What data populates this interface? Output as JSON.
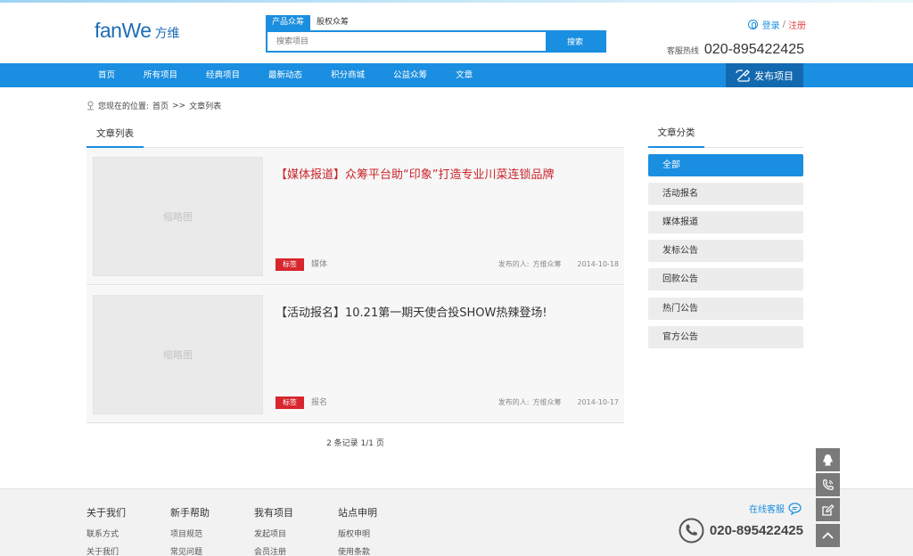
{
  "header": {
    "logo_word": "fanWe",
    "logo_cn": "方维",
    "search_tabs": [
      "产品众筹",
      "股权众筹"
    ],
    "search_placeholder": "搜索项目",
    "search_button": "搜索",
    "login": "登录",
    "separator": "/",
    "register": "注册",
    "hotline_label": "客服热线",
    "hotline_number": "020-895422425"
  },
  "nav": {
    "items": [
      "首页",
      "所有项目",
      "经典项目",
      "最新动态",
      "积分商城",
      "公益众筹",
      "文章"
    ],
    "publish": "发布项目"
  },
  "breadcrumb": {
    "prefix": "您现在的位置:",
    "home": "首页",
    "sep": ">>",
    "current": "文章列表"
  },
  "main": {
    "tab": "文章列表",
    "articles": [
      {
        "thumb": "缩略图",
        "title": "【媒体报道】众筹平台助“印象”打造专业川菜连锁品牌",
        "tag": "标签",
        "tag_value": "媒体",
        "author_label": "发布的人:",
        "author": "方维众筹",
        "date": "2014-10-18"
      },
      {
        "thumb": "缩略图",
        "title": "【活动报名】10.21第一期天使合投SHOW热辣登场!",
        "tag": "标签",
        "tag_value": "报名",
        "author_label": "发布的人:",
        "author": "方维众筹",
        "date": "2014-10-17"
      }
    ],
    "pager": "2 条记录 1/1 页"
  },
  "sidebar": {
    "title": "文章分类",
    "categories": [
      "全部",
      "活动报名",
      "媒体报道",
      "发标公告",
      "回款公告",
      "热门公告",
      "官方公告"
    ]
  },
  "footer": {
    "columns": [
      {
        "head": "关于我们",
        "links": [
          "联系方式",
          "关于我们"
        ]
      },
      {
        "head": "新手帮助",
        "links": [
          "项目规范",
          "常见问题"
        ]
      },
      {
        "head": "我有项目",
        "links": [
          "发起项目",
          "会员注册"
        ]
      },
      {
        "head": "站点申明",
        "links": [
          "版权申明",
          "使用条款"
        ]
      }
    ],
    "service": "在线客服",
    "phone": "020-895422425"
  },
  "colors": {
    "primary": "#1a8ee0",
    "publish_bg": "#1369b0",
    "tag_red": "#d7262e",
    "title_red": "#c9242b"
  },
  "icons": {
    "float": [
      "qq-icon",
      "phone-icon",
      "edit-icon",
      "back-to-top-icon"
    ]
  }
}
